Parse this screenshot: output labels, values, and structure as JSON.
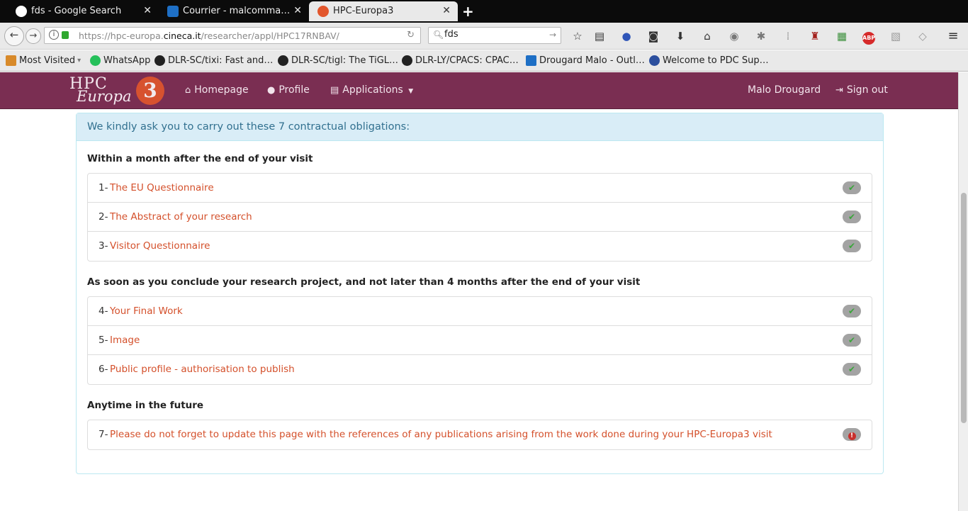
{
  "browser": {
    "tabs": [
      {
        "title": "fds - Google Search",
        "active": false,
        "favicon": "google-icon"
      },
      {
        "title": "Courrier - malcomma…",
        "active": false,
        "favicon": "outlook-icon"
      },
      {
        "title": "HPC-Europa3",
        "active": true,
        "favicon": "hpc-europa3-icon"
      }
    ],
    "url_prefix": "https://hpc-europa.",
    "url_host": "cineca.it",
    "url_path": "/researcher/appl/HPC17RNBAV/",
    "search_value": "fds",
    "bookmarks": [
      {
        "label": "Most Visited",
        "icon": "folder-icon"
      },
      {
        "label": "WhatsApp",
        "icon": "whatsapp-icon"
      },
      {
        "label": "DLR-SC/tixi: Fast and…",
        "icon": "github-icon"
      },
      {
        "label": "DLR-SC/tigl: The TiGL…",
        "icon": "github-icon"
      },
      {
        "label": "DLR-LY/CPACS: CPAC…",
        "icon": "github-icon"
      },
      {
        "label": "Drougard Malo - Outl…",
        "icon": "outlook-icon"
      },
      {
        "label": "Welcome to PDC Sup…",
        "icon": "pdc-icon"
      }
    ]
  },
  "site": {
    "logo_text_1": "HPC",
    "logo_text_2": "Europa",
    "logo_text_3": "3",
    "nav": {
      "home": "Homepage",
      "profile": "Profile",
      "applications": "Applications",
      "user": "Malo Drougard",
      "signout": "Sign out"
    }
  },
  "obligations": {
    "heading": "We kindly ask you to carry out these 7 contractual obligations:",
    "sections": [
      {
        "title": "Within a month after the end of your visit",
        "items": [
          {
            "num": "1-",
            "label": "The EU Questionnaire",
            "status": "done"
          },
          {
            "num": "2-",
            "label": "The Abstract of your research",
            "status": "done"
          },
          {
            "num": "3-",
            "label": "Visitor Questionnaire",
            "status": "done"
          }
        ]
      },
      {
        "title": "As soon as you conclude your research project, and not later than 4 months after the end of your visit",
        "items": [
          {
            "num": "4-",
            "label": "Your Final Work",
            "status": "done"
          },
          {
            "num": "5-",
            "label": "Image",
            "status": "done"
          },
          {
            "num": "6-",
            "label": "Public profile - authorisation to publish",
            "status": "done"
          }
        ]
      },
      {
        "title": "Anytime in the future",
        "items": [
          {
            "num": "7-",
            "label": "Please do not forget to update this page with the references of any publications arising from the work done during your HPC-Europa3 visit",
            "status": "pending"
          }
        ]
      }
    ]
  },
  "colors": {
    "brand": "#7a2e52",
    "link": "#d4502b",
    "info_bg": "#d9edf7",
    "info_text": "#31708f"
  }
}
